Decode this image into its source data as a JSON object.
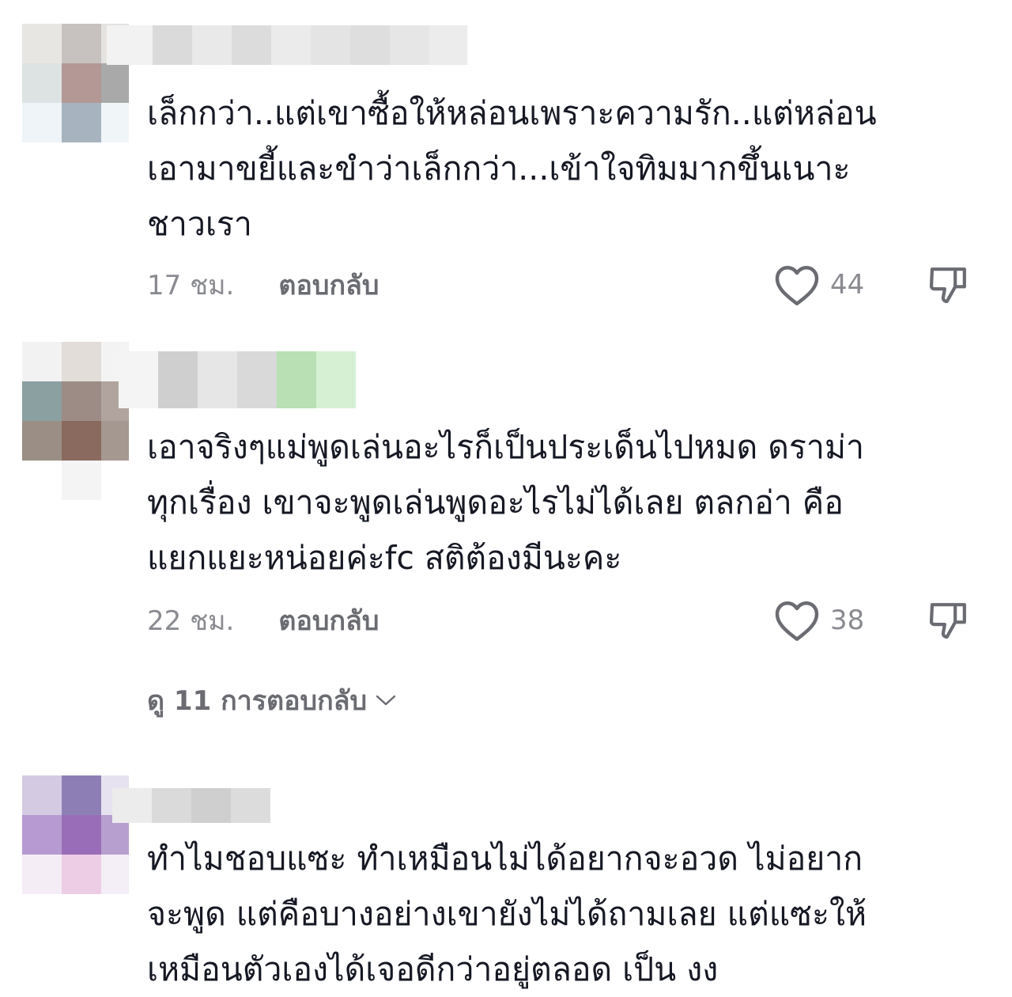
{
  "comments": [
    {
      "text": "เล็กกว่า..แต่เขาซื้อให้หล่อนเพราะความรัก..แต่หล่อน\nเอามาขยี้และขำว่าเล็กกว่า...เข้าใจทิมมากขึ้นเนาะ\nชาวเรา",
      "time": "17 ชม.",
      "reply_label": "ตอบกลับ",
      "likes": "44"
    },
    {
      "text": "เอาจริงๆแม่พูดเล่นอะไรก็เป็นประเด็นไปหมด ดราม่า\nทุกเรื่อง เขาจะพูดเล่นพูดอะไรไม่ได้เลย ตลกอ่า คือ\nแยกแยะหน่อยค่ะfc สติต้องมีนะคะ",
      "time": "22 ชม.",
      "reply_label": "ตอบกลับ",
      "likes": "38",
      "view_replies": "ดู 11 การตอบกลับ"
    },
    {
      "text": "ทำไมชอบแซะ ทำเหมือนไม่ได้อยากจะอวด ไม่อยาก\nจะพูด แต่คือบางอย่างเขายังไม่ได้ถามเลย แต่แซะให้\nเหมือนตัวเองได้เจอดีกว่าอยู่ตลอด เป็น งง"
    }
  ],
  "icons": {
    "like": "heart-outline-icon",
    "dislike": "thumbs-down-icon",
    "expand": "chevron-down-icon"
  },
  "colors": {
    "text_primary": "#161823",
    "text_secondary": "#8a8b91"
  }
}
